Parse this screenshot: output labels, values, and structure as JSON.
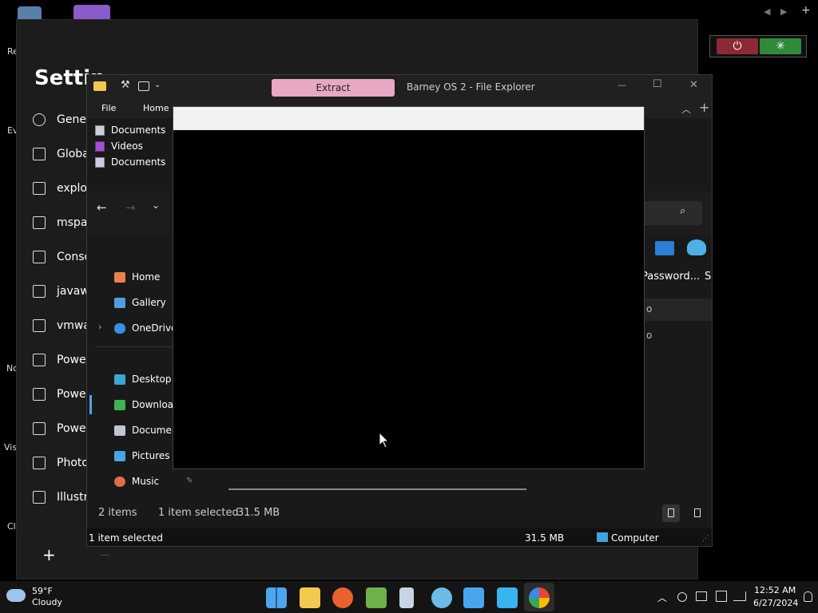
{
  "desktop": {
    "icons": [
      {
        "label": "Re"
      },
      {
        "label": "Ev"
      },
      {
        "label": "No"
      },
      {
        "label": "Vis"
      },
      {
        "label": "Cl"
      }
    ]
  },
  "gadget": {
    "nav_prev": "◀",
    "nav_next": "▶",
    "nav_add": "+",
    "power_glyph": "⏻",
    "spin_glyph": "✳",
    "colors": {
      "power": "#8b2a36",
      "spin": "#2f8a3a"
    }
  },
  "settings": {
    "title": "Settin",
    "items": [
      {
        "label": "Gener",
        "icon": "gear-icon"
      },
      {
        "label": "Globa",
        "icon": "window-icon"
      },
      {
        "label": "explor",
        "icon": "app-icon"
      },
      {
        "label": "mspai",
        "icon": "app-icon"
      },
      {
        "label": "Conso",
        "icon": "window-icon"
      },
      {
        "label": "javaw",
        "icon": "app-icon"
      },
      {
        "label": "vmwa",
        "icon": "app-icon"
      },
      {
        "label": "Power",
        "icon": "app-icon"
      },
      {
        "label": "Power",
        "icon": "app-icon"
      },
      {
        "label": "Power",
        "icon": "app-icon"
      },
      {
        "label": "Photo",
        "icon": "app-icon"
      },
      {
        "label": "Illustra",
        "icon": "app-icon"
      }
    ],
    "add_label": "+",
    "remove_label": "—"
  },
  "explorer": {
    "title": "Barney OS 2 - File Explorer",
    "extract_label": "Extract",
    "minimize": "—",
    "maximize": "☐",
    "close": "✕",
    "tabs": [
      "File",
      "Home"
    ],
    "expand_ribbon": "︿",
    "quick_access": [
      {
        "label": "Documents",
        "icon": "document-icon"
      },
      {
        "label": "Videos",
        "icon": "videos-icon"
      },
      {
        "label": "Documents",
        "icon": "document-icon"
      }
    ],
    "back": "←",
    "forward": "→",
    "recent": "⌄",
    "search_glyph": "⌕",
    "right_icons": [
      {
        "label": "Password...",
        "icon": "mail-icon"
      },
      {
        "label": "Si",
        "icon": "shell-icon"
      }
    ],
    "right_rows": [
      "o",
      "o"
    ],
    "nav": [
      {
        "label": "Home",
        "icon": "home-icon",
        "color": "#e9804e"
      },
      {
        "label": "Gallery",
        "icon": "gallery-icon",
        "color": "#4f9fde"
      },
      {
        "label": "OneDrive",
        "icon": "onedrive-icon",
        "color": "#3a8ee6"
      },
      {
        "label": "Desktop",
        "icon": "desktop-icon",
        "color": "#3ea5d8"
      },
      {
        "label": "Downloa",
        "icon": "download-icon",
        "color": "#3fb34f"
      },
      {
        "label": "Documen",
        "icon": "document-icon",
        "color": "#c0c6d2"
      },
      {
        "label": "Pictures",
        "icon": "pictures-icon",
        "color": "#4aa3e6"
      },
      {
        "label": "Music",
        "icon": "music-icon",
        "color": "#e06d4a"
      }
    ],
    "status": {
      "items": "2 items",
      "selected": "1 item selected",
      "size": "31.5 MB"
    },
    "bottom": {
      "selected": "1 item selected",
      "size": "31.5 MB",
      "location": "Computer"
    }
  },
  "taskbar": {
    "weather_temp": "59°F",
    "weather_desc": "Cloudy",
    "time": "12:52 AM",
    "date": "6/27/2024",
    "tray_up": "︿",
    "apps": [
      "start-icon",
      "file-explorer-icon",
      "firefox-icon",
      "tb-icon",
      "notepad-icon",
      "shell-icon",
      "windows-icon",
      "blue-app-icon",
      "google-icon"
    ]
  }
}
